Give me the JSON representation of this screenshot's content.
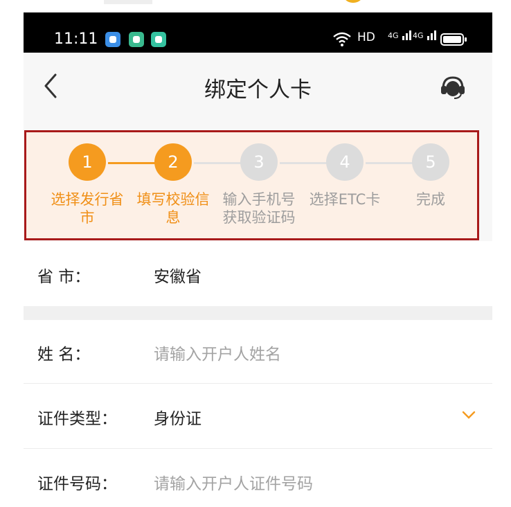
{
  "status_bar": {
    "time": "11:11",
    "network": "HD",
    "signal_1": "4G",
    "signal_2": "4G",
    "icons": [
      "wifi-icon",
      "battery-icon"
    ]
  },
  "header": {
    "title": "绑定个人卡",
    "back_icon": "chevron-left-icon",
    "service_icon": "headset-icon"
  },
  "steps": [
    {
      "num": "1",
      "label": "选择发行省市",
      "state": "done"
    },
    {
      "num": "2",
      "label": "填写校验信息",
      "state": "current"
    },
    {
      "num": "3",
      "label": "输入手机号获取验证码",
      "state": "todo"
    },
    {
      "num": "4",
      "label": "选择ETC卡",
      "state": "todo"
    },
    {
      "num": "5",
      "label": "完成",
      "state": "todo"
    }
  ],
  "form": {
    "province": {
      "label": "省     市：",
      "value": "安徽省"
    },
    "name": {
      "label": "姓     名：",
      "placeholder": "请输入开户人姓名"
    },
    "id_type": {
      "label": "证件类型：",
      "value": "身份证"
    },
    "id_number": {
      "label": "证件号码：",
      "placeholder": "请输入开户人证件号码"
    }
  },
  "colors": {
    "accent": "#f59b1f",
    "highlight_border": "#a81a1a",
    "steps_bg": "#fdf0e6",
    "inactive": "#dcdcdc"
  }
}
